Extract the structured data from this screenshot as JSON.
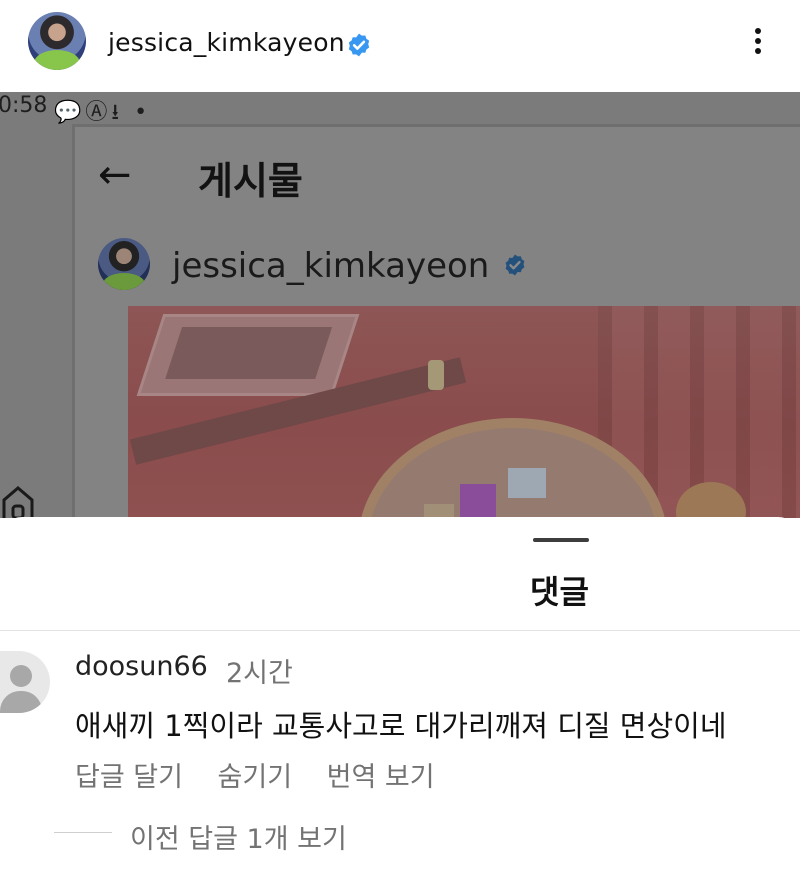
{
  "header": {
    "username": "jessica_kimkayeon",
    "verified": true,
    "more_icon": "kebab-icon"
  },
  "embedded_screenshot": {
    "status_time": "0:58",
    "status_icons": "💬Ⓐ⭳ •",
    "back_icon": "back-arrow-icon",
    "title": "게시물",
    "username": "jessica_kimkayeon",
    "verified": true
  },
  "sheet": {
    "title": "댓글"
  },
  "comment": {
    "username": "doosun66",
    "time": "2시간",
    "text": "애새끼 1찍이라 교통사고로 대가리깨져 디질 면상이네",
    "actions": [
      "답글 달기",
      "숨기기",
      "번역 보기"
    ],
    "view_previous": "이전 답글 1개 보기"
  },
  "colors": {
    "verified_blue": "#3897f0",
    "secondary_text": "#737373",
    "dim_overlay": "#7b7b7b"
  }
}
